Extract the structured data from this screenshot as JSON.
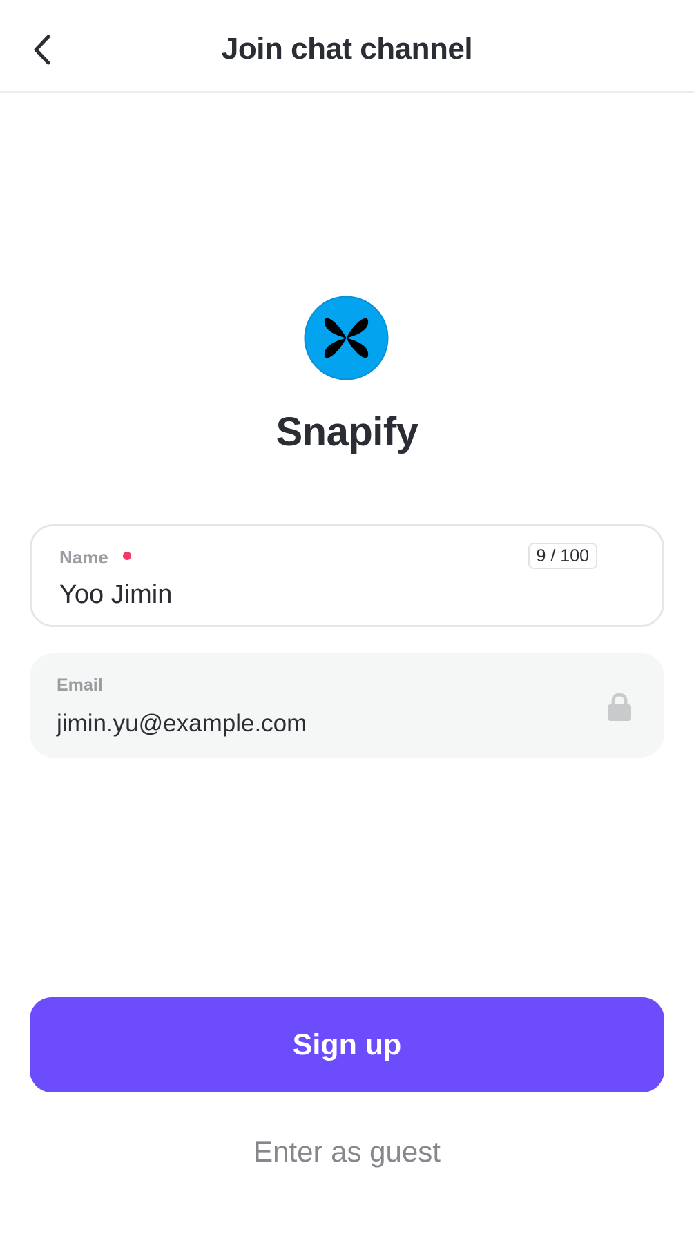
{
  "header": {
    "title": "Join chat channel",
    "back_icon": "chevron-left-icon"
  },
  "brand": {
    "name": "Snapify",
    "logo_icon": "butterfly-logo-icon",
    "logo_color": "#03a3f0"
  },
  "form": {
    "name": {
      "label": "Name",
      "required": true,
      "value": "Yoo Jimin",
      "counter": "9 / 100"
    },
    "email": {
      "label": "Email",
      "value": "jimin.yu@example.com",
      "locked": true,
      "lock_icon": "lock-icon"
    }
  },
  "actions": {
    "signup_label": "Sign up",
    "guest_label": "Enter as guest"
  },
  "colors": {
    "accent": "#6d4dfb",
    "required_dot": "#f03a6b"
  }
}
